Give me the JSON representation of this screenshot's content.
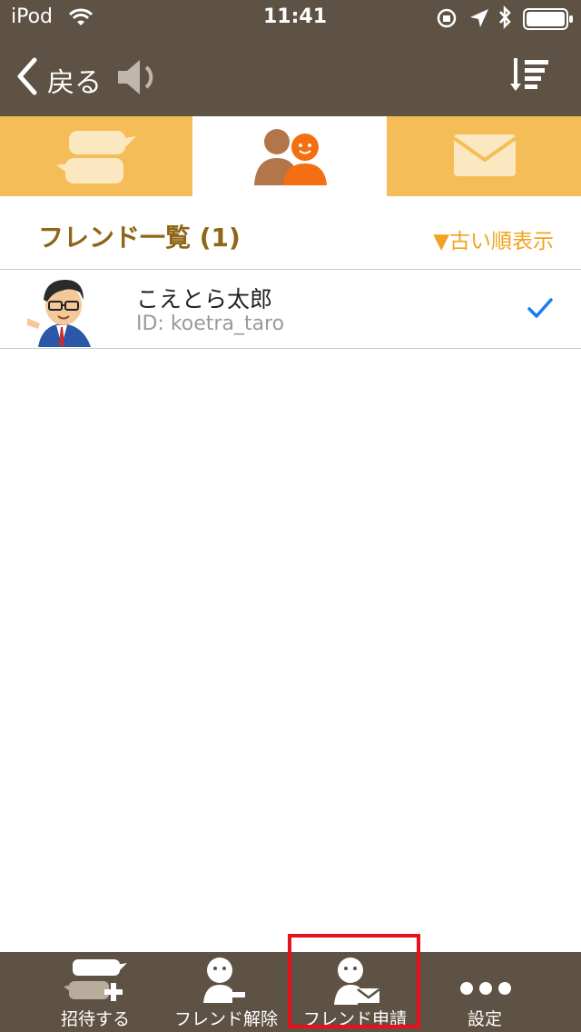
{
  "status_bar": {
    "device": "iPod",
    "time": "11:41"
  },
  "nav": {
    "back_label": "戻る"
  },
  "tabs": [
    "chat",
    "friends",
    "mail"
  ],
  "friends": {
    "title": "フレンド一覧 (1)",
    "sort_label": "▼古い順表示",
    "items": [
      {
        "name": "こえとら太郎",
        "id": "ID: koetra_taro",
        "selected": true
      }
    ]
  },
  "toolbar": {
    "invite": "招待する",
    "remove_friend": "フレンド解除",
    "friend_request": "フレンド申請",
    "settings": "設定"
  },
  "colors": {
    "header_bg": "#5d5244",
    "tab_accent": "#f4bd57",
    "title": "#8f6618",
    "sort": "#f0a31e",
    "check": "#1a7cf0",
    "highlight": "#e8111b"
  }
}
